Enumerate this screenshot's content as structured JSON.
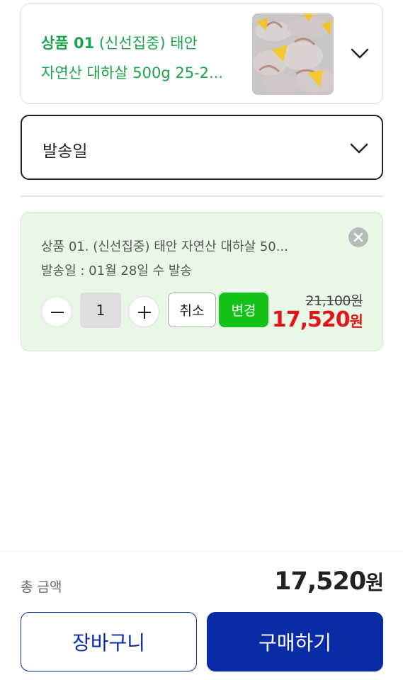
{
  "product_select": {
    "prefix": "상품 01",
    "line1_rest": " (신선집중) 태안",
    "line2": "자연산  대하살 500g 25-2...",
    "thumbnail_icon": "shrimp-with-lemon-image",
    "toggle_icon": "chevron-down-icon"
  },
  "ship_select": {
    "label": "발송일",
    "toggle_icon": "chevron-down-icon"
  },
  "selected_item": {
    "name": "상품 01. (신선집중) 태안 자연산  대하살 50...",
    "ship_date": "발송일 : 01월 28일 수 발송",
    "quantity": "1",
    "cancel_label": "취소",
    "change_label": "변경",
    "original_price": "21,100원",
    "sale_price": "17,520",
    "sale_unit": "원",
    "remove_icon": "close-circle-icon",
    "minus_icon": "minus-icon",
    "plus_icon": "plus-icon"
  },
  "summary": {
    "total_label": "총 금액",
    "total_amount": "17,520",
    "total_unit": "원"
  },
  "actions": {
    "cart_label": "장바구니",
    "buy_label": "구매하기"
  },
  "colors": {
    "brand_blue": "#0a2ba6",
    "accent_green": "#14c31a",
    "title_green": "#1aa34a",
    "sale_red": "#e0161b",
    "card_bg": "#e9f8e6"
  }
}
